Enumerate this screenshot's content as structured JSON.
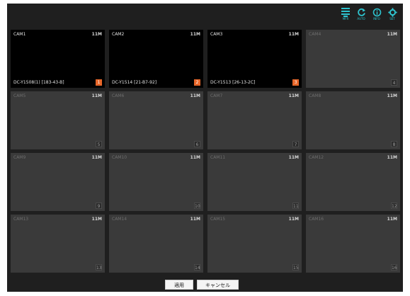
{
  "toolbar": {
    "buttons": [
      {
        "name": "list-icon",
        "caption": "MFR"
      },
      {
        "name": "refresh-icon",
        "caption": "AUTO"
      },
      {
        "name": "info-icon",
        "caption": "INFO"
      },
      {
        "name": "gear-icon",
        "caption": "SET"
      }
    ],
    "accent": "#2ec4cf"
  },
  "tiles": [
    {
      "name": "CAM1",
      "res": "11M",
      "model": "DC-Y1508(1) [183-43-B]",
      "channel": "1",
      "active": true
    },
    {
      "name": "CAM2",
      "res": "11M",
      "model": "DC-Y1514 [21-B7-92]",
      "channel": "2",
      "active": true
    },
    {
      "name": "CAM3",
      "res": "11M",
      "model": "DC-Y1513 [26-13-2C]",
      "channel": "3",
      "active": true
    },
    {
      "name": "CAM4",
      "res": "11M",
      "model": "",
      "channel": "4",
      "active": false
    },
    {
      "name": "CAM5",
      "res": "11M",
      "model": "",
      "channel": "5",
      "active": false
    },
    {
      "name": "CAM6",
      "res": "11M",
      "model": "",
      "channel": "6",
      "active": false
    },
    {
      "name": "CAM7",
      "res": "11M",
      "model": "",
      "channel": "7",
      "active": false
    },
    {
      "name": "CAM8",
      "res": "11M",
      "model": "",
      "channel": "8",
      "active": false
    },
    {
      "name": "CAM9",
      "res": "11M",
      "model": "",
      "channel": "9",
      "active": false
    },
    {
      "name": "CAM10",
      "res": "11M",
      "model": "",
      "channel": "10",
      "active": false
    },
    {
      "name": "CAM11",
      "res": "11M",
      "model": "",
      "channel": "11",
      "active": false
    },
    {
      "name": "CAM12",
      "res": "11M",
      "model": "",
      "channel": "12",
      "active": false
    },
    {
      "name": "CAM13",
      "res": "11M",
      "model": "",
      "channel": "13",
      "active": false
    },
    {
      "name": "CAM14",
      "res": "11M",
      "model": "",
      "channel": "14",
      "active": false
    },
    {
      "name": "CAM15",
      "res": "11M",
      "model": "",
      "channel": "15",
      "active": false
    },
    {
      "name": "CAM16",
      "res": "11M",
      "model": "",
      "channel": "16",
      "active": false
    }
  ],
  "footer": {
    "apply_label": "適用",
    "cancel_label": "キャンセル"
  },
  "colors": {
    "background": "#1f1f1f",
    "tile_idle": "#3a3a3a",
    "tile_active": "#000000",
    "channel_badge_active": "#e8672a"
  }
}
